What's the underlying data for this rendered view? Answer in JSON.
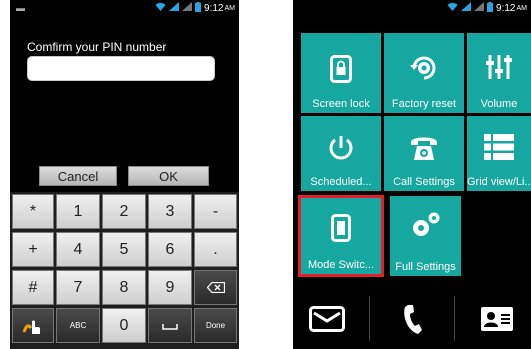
{
  "left_phone": {
    "status": {
      "time": "9:12",
      "ampm": "AM"
    },
    "pin_label": "Comfirm your PIN number",
    "pin_value": "",
    "cancel_label": "Cancel",
    "ok_label": "OK",
    "keys": {
      "r1": [
        "*",
        "1",
        "2",
        "3",
        "-"
      ],
      "r2": [
        "+",
        "4",
        "5",
        "6",
        "."
      ],
      "r3": [
        "#",
        "7",
        "8",
        "9"
      ],
      "r4_abc": "ABC",
      "r4_zero": "0",
      "r4_done": "Done"
    }
  },
  "right_phone": {
    "status": {
      "time": "9:12",
      "ampm": "AM"
    },
    "tiles": [
      {
        "label": "Screen lock",
        "icon": "lock-phone-icon"
      },
      {
        "label": "Factory reset",
        "icon": "reset-gear-icon"
      },
      {
        "label": "Volume",
        "icon": "sliders-icon"
      },
      {
        "label": "Scheduled...",
        "icon": "power-icon"
      },
      {
        "label": "Call Settings",
        "icon": "phone-gear-icon"
      },
      {
        "label": "Grid view/Li...",
        "icon": "list-icon"
      },
      {
        "label": "Mode Switc...",
        "icon": "phone-icon"
      },
      {
        "label": "Full Settings",
        "icon": "gears-icon"
      }
    ],
    "dock": [
      "messages-icon",
      "phone-icon",
      "contacts-icon"
    ]
  },
  "colors": {
    "tile": "#16a8a0",
    "highlight": "#e41e2a"
  }
}
